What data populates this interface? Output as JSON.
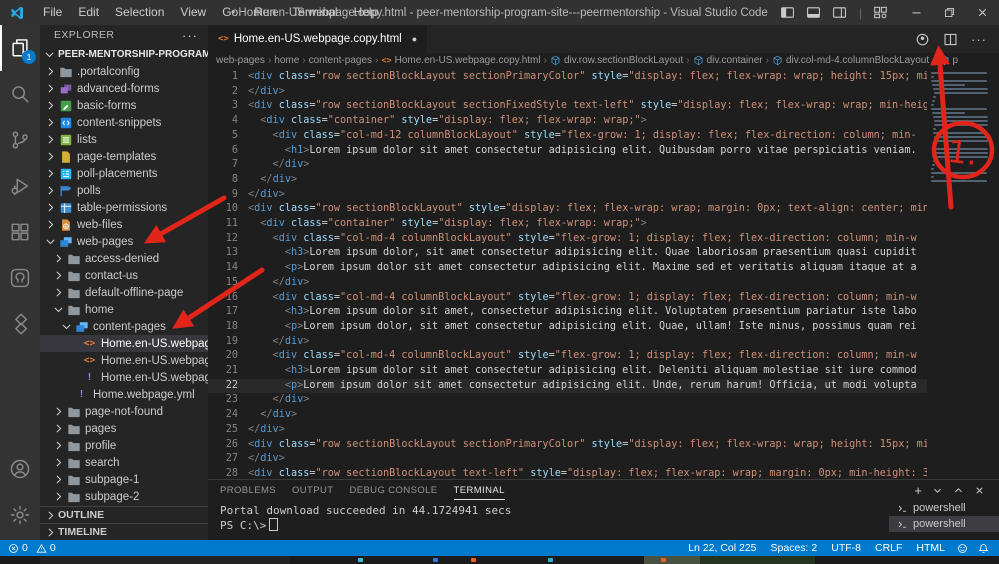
{
  "title_bar": {
    "menus": [
      "File",
      "Edit",
      "Selection",
      "View",
      "Go",
      "Run",
      "Terminal",
      "Help"
    ],
    "title": "• Home.en-US.webpage.copy.html - peer-mentorship-program-site---peermentorship - Visual Studio Code"
  },
  "activity_bar": {
    "top": [
      {
        "name": "explorer",
        "badge": "1",
        "active": true
      },
      {
        "name": "search"
      },
      {
        "name": "source-control"
      },
      {
        "name": "run-debug"
      },
      {
        "name": "extensions"
      },
      {
        "name": "github"
      },
      {
        "name": "power-platform"
      }
    ],
    "bottom": [
      {
        "name": "account"
      },
      {
        "name": "settings"
      }
    ]
  },
  "explorer": {
    "header": "EXPLORER",
    "root": "PEER-MENTORSHIP-PROGRAM-SIT...",
    "items": [
      {
        "label": ".portalconfig",
        "icon": "folder",
        "chevron": "right",
        "level": 1
      },
      {
        "label": "advanced-forms",
        "icon": "advanced-forms",
        "chevron": "right",
        "level": 1
      },
      {
        "label": "basic-forms",
        "icon": "basic-forms",
        "chevron": "right",
        "level": 1
      },
      {
        "label": "content-snippets",
        "icon": "content-snippets",
        "chevron": "right",
        "level": 1
      },
      {
        "label": "lists",
        "icon": "lists",
        "chevron": "right",
        "level": 1
      },
      {
        "label": "page-templates",
        "icon": "page-templates",
        "chevron": "right",
        "level": 1
      },
      {
        "label": "poll-placements",
        "icon": "poll-placements",
        "chevron": "right",
        "level": 1
      },
      {
        "label": "polls",
        "icon": "polls",
        "chevron": "right",
        "level": 1
      },
      {
        "label": "table-permissions",
        "icon": "table-permissions",
        "chevron": "right",
        "level": 1
      },
      {
        "label": "web-files",
        "icon": "web-files",
        "chevron": "right",
        "level": 1
      },
      {
        "label": "web-pages",
        "icon": "pages",
        "chevron": "down",
        "level": 1
      },
      {
        "label": "access-denied",
        "icon": "folder",
        "chevron": "right",
        "level": 2
      },
      {
        "label": "contact-us",
        "icon": "folder",
        "chevron": "right",
        "level": 2
      },
      {
        "label": "default-offline-page",
        "icon": "folder",
        "chevron": "right",
        "level": 2
      },
      {
        "label": "home",
        "icon": "folder",
        "chevron": "down",
        "level": 2
      },
      {
        "label": "content-pages",
        "icon": "pages",
        "chevron": "down",
        "level": 3
      },
      {
        "label": "Home.en-US.webpag...",
        "icon": "html",
        "chevron": "none",
        "level": 4,
        "selected": true
      },
      {
        "label": "Home.en-US.webpag...",
        "icon": "html",
        "chevron": "none",
        "level": 4
      },
      {
        "label": "Home.en-US.webpag...",
        "icon": "yaml",
        "chevron": "none",
        "level": 4
      },
      {
        "label": "Home.webpage.yml",
        "icon": "yaml",
        "chevron": "none",
        "level": 3
      },
      {
        "label": "page-not-found",
        "icon": "folder",
        "chevron": "right",
        "level": 2
      },
      {
        "label": "pages",
        "icon": "folder",
        "chevron": "right",
        "level": 2
      },
      {
        "label": "profile",
        "icon": "folder",
        "chevron": "right",
        "level": 2
      },
      {
        "label": "search",
        "icon": "folder",
        "chevron": "right",
        "level": 2
      },
      {
        "label": "subpage-1",
        "icon": "folder",
        "chevron": "right",
        "level": 2
      },
      {
        "label": "subpage-2",
        "icon": "folder",
        "chevron": "right",
        "level": 2
      }
    ],
    "sections": [
      "OUTLINE",
      "TIMELINE"
    ]
  },
  "editor": {
    "tab": {
      "label": "Home.en-US.webpage.copy.html",
      "icon": "html",
      "modified_dot": "●"
    },
    "breadcrumbs": [
      {
        "label": "web-pages"
      },
      {
        "label": "home"
      },
      {
        "label": "content-pages"
      },
      {
        "label": "Home.en-US.webpage.copy.html",
        "icon": "html"
      },
      {
        "label": "div.row.sectionBlockLayout",
        "icon": "element"
      },
      {
        "label": "div.container",
        "icon": "element"
      },
      {
        "label": "div.col-md-4.columnBlockLayout",
        "icon": "element"
      },
      {
        "label": "p",
        "icon": "element"
      }
    ],
    "current_line": 22,
    "lines": [
      "<div class=\"row sectionBlockLayout sectionPrimaryColor\" style=\"display: flex; flex-wrap: wrap; height: 15px; mi",
      "</div>",
      "<div class=\"row sectionBlockLayout sectionFixedStyle text-left\" style=\"display: flex; flex-wrap: wrap; min-heig",
      "  <div class=\"container\" style=\"display: flex; flex-wrap: wrap;\">",
      "    <div class=\"col-md-12 columnBlockLayout\" style=\"flex-grow: 1; display: flex; flex-direction: column; min-",
      "      <h1>Lorem ipsum dolor sit amet consectetur adipisicing elit. Quibusdam porro vitae perspiciatis veniam.",
      "    </div>",
      "  </div>",
      "</div>",
      "<div class=\"row sectionBlockLayout\" style=\"display: flex; flex-wrap: wrap; margin: 0px; text-align: center; min",
      "  <div class=\"container\" style=\"display: flex; flex-wrap: wrap;\">",
      "    <div class=\"col-md-4 columnBlockLayout\" style=\"flex-grow: 1; display: flex; flex-direction: column; min-w",
      "      <h3>Lorem ipsum dolor, sit amet consectetur adipisicing elit. Quae laboriosam praesentium quasi cupidit",
      "      <p>Lorem ipsum dolor sit amet consectetur adipisicing elit. Maxime sed et veritatis aliquam itaque at a",
      "    </div>",
      "    <div class=\"col-md-4 columnBlockLayout\" style=\"flex-grow: 1; display: flex; flex-direction: column; min-w",
      "      <h3>Lorem ipsum dolor sit amet, consectetur adipisicing elit. Voluptatem praesentium pariatur iste labo",
      "      <p>Lorem ipsum dolor, sit amet consectetur adipisicing elit. Quae, ullam! Iste minus, possimus quam rei",
      "    </div>",
      "    <div class=\"col-md-4 columnBlockLayout\" style=\"flex-grow: 1; display: flex; flex-direction: column; min-w",
      "      <h3>Lorem ipsum dolor sit amet consectetur adipisicing elit. Deleniti aliquam molestiae sit iure commod",
      "      <p>Lorem ipsum dolor sit amet consectetur adipisicing elit. Unde, rerum harum! Officia, ut modi volupta",
      "    </div>",
      "  </div>",
      "</div>",
      "<div class=\"row sectionBlockLayout sectionPrimaryColor\" style=\"display: flex; flex-wrap: wrap; height: 15px; mi",
      "</div>",
      "<div class=\"row sectionBlockLayout text-left\" style=\"display: flex; flex-wrap: wrap; margin: 0px; min-height: 3"
    ]
  },
  "panel": {
    "tabs": [
      {
        "label": "PROBLEMS"
      },
      {
        "label": "OUTPUT"
      },
      {
        "label": "DEBUG CONSOLE"
      },
      {
        "label": "TERMINAL",
        "active": true
      }
    ],
    "output": "Portal download succeeded in 44.1724941 secs",
    "prompt": "PS C:\\>",
    "terminals": [
      {
        "label": "powershell"
      },
      {
        "label": "powershell",
        "selected": true
      }
    ]
  },
  "status_bar": {
    "problems": {
      "errors": "0",
      "warnings": "0"
    },
    "right_items": [
      "Ln 22, Col 225",
      "Spaces: 2",
      "UTF-8",
      "CRLF",
      "HTML"
    ]
  },
  "annotations": {
    "circle_label": "1."
  },
  "colors": {
    "accent": "#007acc",
    "annotation_red": "#e1251b",
    "html_icon": "#e37933",
    "yaml_icon": "#b180d7",
    "tag_blue": "#569cd6",
    "attr_blue": "#9cdcfe",
    "string_orange": "#ce9178"
  }
}
